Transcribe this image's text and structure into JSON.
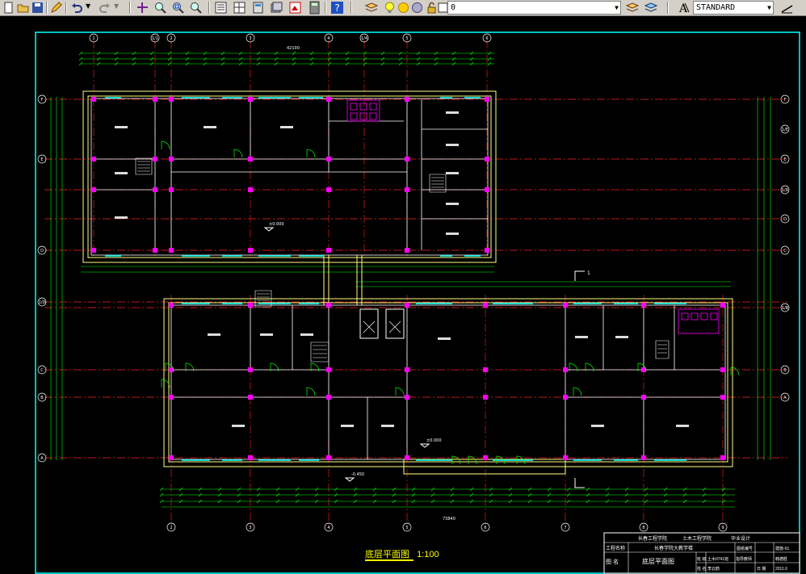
{
  "toolbar": {
    "textstyle_value": "STANDARD",
    "layer_value": "0",
    "icons": [
      "new-icon",
      "open-icon",
      "save-icon",
      "pencil-icon",
      "undo-icon",
      "redo-icon",
      "pan-icon",
      "zoom-realtime-icon",
      "zoom-window-icon",
      "zoom-previous-icon",
      "properties-icon",
      "design-center-icon",
      "tool-palette-icon",
      "sheet-set-icon",
      "markup-icon",
      "calculator-icon",
      "help-icon",
      "layer-manager-icon",
      "lightbulb-icon",
      "sun-icon",
      "lock-icon",
      "text-style-icon",
      "dim-style-icon"
    ]
  },
  "drawing": {
    "caption": "底层平面图",
    "scale": "1:100",
    "grid_top_labels": [
      "1",
      "1/1",
      "2",
      "3",
      "4",
      "1/4",
      "5",
      "6"
    ],
    "grid_bottom_labels": [
      "2",
      "3",
      "4",
      "5",
      "6",
      "7",
      "8",
      "9"
    ],
    "grid_left_labels": [
      "F",
      "E",
      "D",
      "1/D",
      "C",
      "B",
      "A"
    ],
    "grid_right_labels": [
      "F",
      "1/E",
      "E",
      "1/D",
      "D",
      "C",
      "1/B",
      "B",
      "A"
    ],
    "overall_dim_top": "42100",
    "overall_dim_bottom": "73840",
    "area_labels": [
      "±0.000",
      "-0.450"
    ],
    "section_mark": "1"
  },
  "title_block": {
    "school": "长春工程学院",
    "dept": "土木工程学院",
    "design": "毕业设计",
    "project_label": "工程名称",
    "project_name": "长春学院大教学楼",
    "sheet_no_label": "图纸编号",
    "sheet_no": "建施-01",
    "drawing_name_label": "图 名",
    "drawing_name": "底层平面图",
    "class_label": "班 级",
    "class_value": "土木0741班",
    "teacher_label": "指导教师",
    "teacher_name": "韩德胜",
    "student_label": "姓 名",
    "student_name": "李云鹤",
    "date_label": "日 期",
    "date": "2011.6"
  }
}
